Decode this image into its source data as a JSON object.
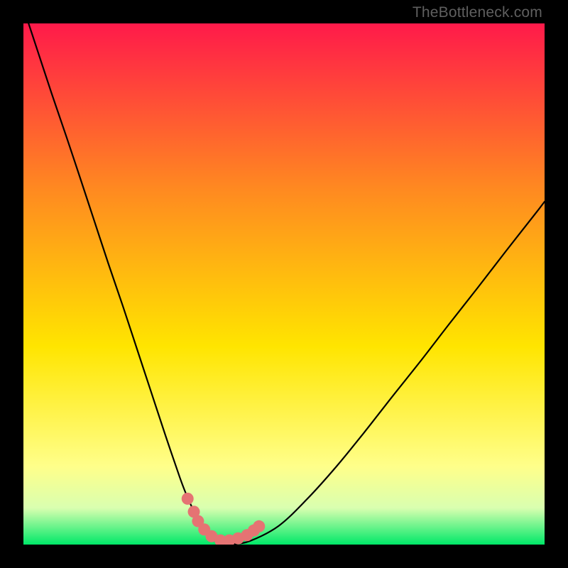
{
  "watermark": "TheBottleneck.com",
  "chart_data": {
    "type": "line",
    "title": "",
    "xlabel": "",
    "ylabel": "",
    "xlim": [
      0,
      100
    ],
    "ylim": [
      0,
      100
    ],
    "grid": false,
    "legend": false,
    "background_gradient": {
      "top": "#ff1a4a",
      "upper_mid": "#ff8a20",
      "mid": "#ffe500",
      "lower": "#ffff8a",
      "bottom": "#00e868"
    },
    "series": [
      {
        "name": "bottleneck-curve",
        "color": "#000000",
        "x": [
          0.0,
          2.7,
          5.4,
          8.2,
          10.9,
          13.6,
          16.3,
          19.1,
          21.8,
          24.5,
          27.2,
          30.0,
          31.3,
          32.7,
          34.0,
          35.4,
          36.7,
          38.1,
          40.1,
          43.5,
          49.0,
          54.4,
          59.9,
          65.3,
          70.7,
          76.2,
          81.6,
          87.1,
          92.5,
          98.0,
          100.0
        ],
        "y": [
          103.0,
          94.8,
          86.6,
          78.4,
          70.3,
          62.1,
          53.9,
          45.7,
          37.5,
          29.3,
          21.1,
          12.9,
          9.5,
          6.4,
          3.8,
          1.9,
          0.7,
          0.1,
          0.1,
          0.7,
          3.6,
          8.7,
          14.8,
          21.4,
          28.3,
          35.2,
          42.2,
          49.2,
          56.2,
          63.2,
          65.8
        ]
      },
      {
        "name": "trough-highlight",
        "color": "#e57373",
        "style": "dots",
        "x": [
          31.5,
          32.7,
          33.5,
          34.7,
          36.1,
          37.8,
          39.5,
          41.2,
          42.9,
          44.2,
          45.2
        ],
        "y": [
          8.8,
          6.3,
          4.5,
          2.9,
          1.6,
          0.8,
          0.8,
          1.2,
          1.8,
          2.7,
          3.5
        ]
      }
    ],
    "annotations": []
  }
}
